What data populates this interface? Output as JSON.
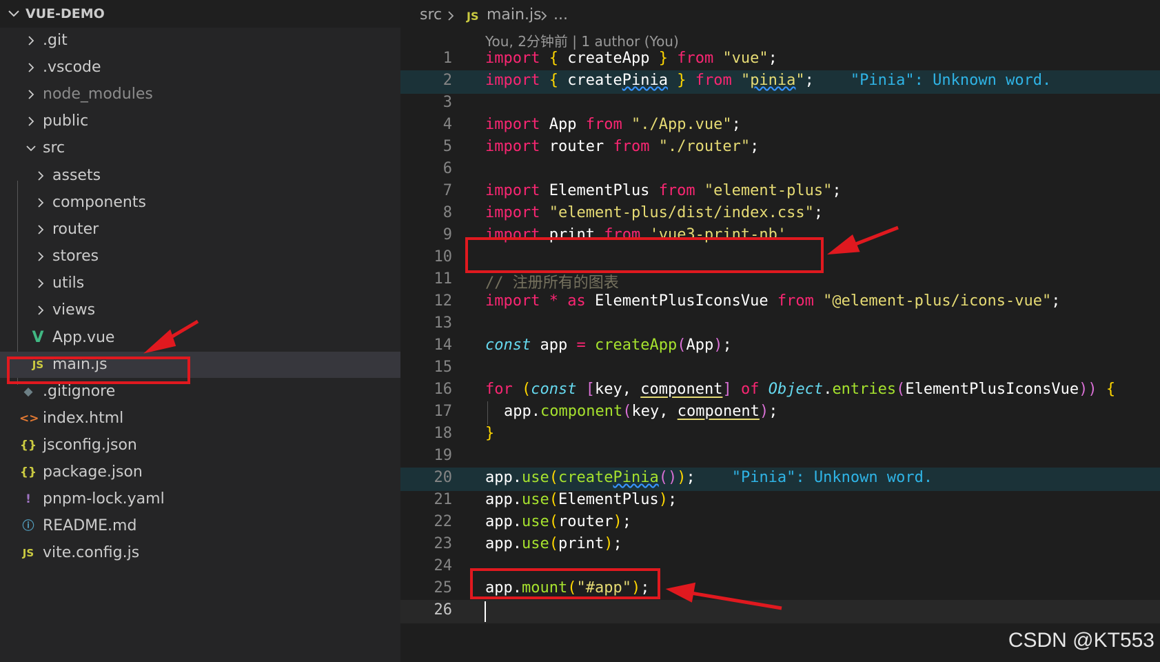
{
  "explorer": {
    "title": "VUE-DEMO",
    "items": [
      {
        "label": ".git",
        "kind": "folder",
        "expanded": false
      },
      {
        "label": ".vscode",
        "kind": "folder",
        "expanded": false
      },
      {
        "label": "node_modules",
        "kind": "folder",
        "expanded": false
      },
      {
        "label": "public",
        "kind": "folder",
        "expanded": false
      },
      {
        "label": "src",
        "kind": "folder",
        "expanded": true
      },
      {
        "label": "assets",
        "kind": "folder",
        "expanded": false
      },
      {
        "label": "components",
        "kind": "folder",
        "expanded": false
      },
      {
        "label": "router",
        "kind": "folder",
        "expanded": false
      },
      {
        "label": "stores",
        "kind": "folder",
        "expanded": false
      },
      {
        "label": "utils",
        "kind": "folder",
        "expanded": false
      },
      {
        "label": "views",
        "kind": "folder",
        "expanded": false
      },
      {
        "label": "App.vue",
        "kind": "vue-file",
        "icon_glyph": "V"
      },
      {
        "label": "main.js",
        "kind": "js-file",
        "icon_glyph": "JS",
        "selected": true
      },
      {
        "label": ".gitignore",
        "kind": "git-file",
        "icon_glyph": "◆"
      },
      {
        "label": "index.html",
        "kind": "html-file",
        "icon_glyph": "<>"
      },
      {
        "label": "jsconfig.json",
        "kind": "json-file",
        "icon_glyph": "{}"
      },
      {
        "label": "package.json",
        "kind": "json-file",
        "icon_glyph": "{}"
      },
      {
        "label": "pnpm-lock.yaml",
        "kind": "yaml-file",
        "icon_glyph": "!"
      },
      {
        "label": "README.md",
        "kind": "info-file",
        "icon_glyph": "ⓘ"
      },
      {
        "label": "vite.config.js",
        "kind": "js-file",
        "icon_glyph": "JS"
      }
    ]
  },
  "breadcrumb": {
    "folder": "src",
    "file_icon": "JS",
    "file": "main.js",
    "more": "..."
  },
  "codelens": "You, 2分钟前 | 1 author (You)",
  "lines": [
    {
      "n": "1"
    },
    {
      "n": "2"
    },
    {
      "n": "3"
    },
    {
      "n": "4"
    },
    {
      "n": "5"
    },
    {
      "n": "6"
    },
    {
      "n": "7"
    },
    {
      "n": "8"
    },
    {
      "n": "9"
    },
    {
      "n": "10"
    },
    {
      "n": "11"
    },
    {
      "n": "12"
    },
    {
      "n": "13"
    },
    {
      "n": "14"
    },
    {
      "n": "15"
    },
    {
      "n": "16"
    },
    {
      "n": "17"
    },
    {
      "n": "18"
    },
    {
      "n": "19"
    },
    {
      "n": "20"
    },
    {
      "n": "21"
    },
    {
      "n": "22"
    },
    {
      "n": "23"
    },
    {
      "n": "24"
    },
    {
      "n": "25"
    },
    {
      "n": "26"
    }
  ],
  "code": {
    "l1": {
      "kw": "import",
      "open": "{",
      "name": "createApp",
      "close": "}",
      "from": "from",
      "src": "\"vue\"",
      "semi": ";"
    },
    "l2": {
      "kw": "import",
      "open": "{",
      "name_a": "create",
      "name_b": "Pinia",
      "close": "}",
      "from": "from",
      "src_q1": "\"",
      "src_word": "pinia",
      "src_q2": "\"",
      "semi": ";",
      "diag": "\"Pinia\": Unknown word."
    },
    "l4": {
      "kw": "import",
      "name": "App",
      "from": "from",
      "src": "\"./App.vue\"",
      "semi": ";"
    },
    "l5": {
      "kw": "import",
      "name": "router",
      "from": "from",
      "src": "\"./router\"",
      "semi": ";"
    },
    "l7": {
      "kw": "import",
      "name": "ElementPlus",
      "from": "from",
      "src": "\"element-plus\"",
      "semi": ";"
    },
    "l8": {
      "kw": "import",
      "src": "\"element-plus/dist/index.css\"",
      "semi": ";"
    },
    "l9": {
      "kw": "import",
      "name": "print",
      "from": "from",
      "src": "'vue3-print-nb'"
    },
    "l11": {
      "comment": "// 注册所有的图表"
    },
    "l12": {
      "kw": "import",
      "star": "*",
      "as": "as",
      "name": "ElementPlusIconsVue",
      "from": "from",
      "src": "\"@element-plus/icons-vue\"",
      "semi": ";"
    },
    "l14": {
      "kw": "const",
      "name": "app",
      "eq": "=",
      "fn": "createApp",
      "po": "(",
      "arg": "App",
      "pc": ")",
      "semi": ";"
    },
    "l16": {
      "kw": "for",
      "po": "(",
      "kw2": "const",
      "bo": "[",
      "a": "key",
      "comma": ",",
      "b": "component",
      "bc": "]",
      "of": "of",
      "obj": "Object",
      "dot": ".",
      "fn": "entries",
      "po2": "(",
      "arg": "ElementPlusIconsVue",
      "pc2": "))",
      "brace": "{"
    },
    "l17": {
      "obj": "app",
      "dot": ".",
      "fn": "component",
      "po": "(",
      "a": "key",
      "comma": ",",
      "b": "component",
      "pc": ")",
      "semi": ";"
    },
    "l18": {
      "brace": "}"
    },
    "l20": {
      "obj": "app",
      "dot": ".",
      "fn": "use",
      "po": "(",
      "fn2a": "create",
      "fn2b": "Pinia",
      "inner": "()",
      "pc": ")",
      "semi": ";",
      "diag": "\"Pinia\": Unknown word."
    },
    "l21": {
      "obj": "app",
      "dot": ".",
      "fn": "use",
      "po": "(",
      "arg": "ElementPlus",
      "pc": ")",
      "semi": ";"
    },
    "l22": {
      "obj": "app",
      "dot": ".",
      "fn": "use",
      "po": "(",
      "arg": "router",
      "pc": ")",
      "semi": ";"
    },
    "l23": {
      "obj": "app",
      "dot": ".",
      "fn": "use",
      "po": "(",
      "arg": "print",
      "pc": ")",
      "semi": ";"
    },
    "l25": {
      "obj": "app",
      "dot": ".",
      "fn": "mount",
      "po": "(",
      "arg": "\"#app\"",
      "pc": ")",
      "semi": ";"
    }
  },
  "watermark": "CSDN @KT553",
  "colors": {
    "annotation_red": "#e0191f",
    "sidebar_bg": "#252526",
    "editor_bg": "#1e1e1e",
    "keyword": "#f92672",
    "string": "#e6db74",
    "function": "#a6e22e",
    "diagnostic": "#2fb4e6"
  }
}
